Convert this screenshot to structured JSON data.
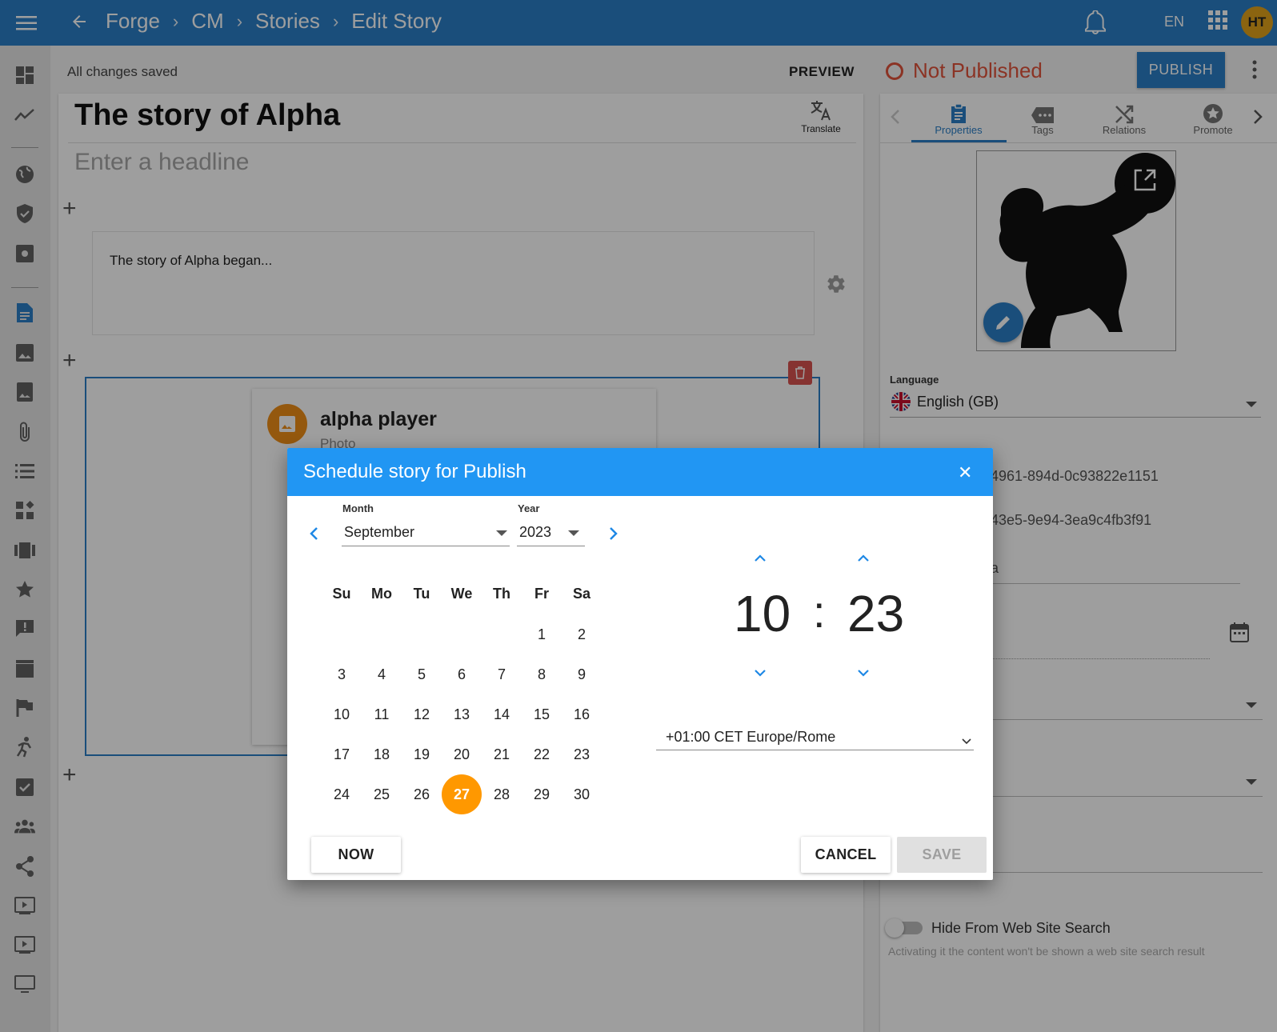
{
  "topbar": {
    "breadcrumbs": [
      "Forge",
      "CM",
      "Stories",
      "Edit Story"
    ],
    "language": "EN",
    "avatar_initials": "HT",
    "color": "#2b7fc7"
  },
  "toolbar": {
    "save_status": "All changes saved",
    "preview_label": "PREVIEW",
    "publish_status": "Not Published",
    "publish_label": "PUBLISH"
  },
  "editor": {
    "title": "The story of Alpha",
    "translate_label": "Translate",
    "headline_placeholder": "Enter a headline",
    "paragraph": "The story of Alpha began...",
    "media_card": {
      "name": "alpha player",
      "type": "Photo"
    }
  },
  "panel": {
    "tabs": [
      {
        "label": "Properties",
        "icon": "clipboard-icon",
        "active": true
      },
      {
        "label": "Tags",
        "icon": "tag-icon",
        "active": false
      },
      {
        "label": "Relations",
        "icon": "shuffle-icon",
        "active": false
      },
      {
        "label": "Promote",
        "icon": "star-circle-icon",
        "active": false
      }
    ],
    "language_label": "Language",
    "language_value": "English (GB)",
    "id_fragment_1": "4961-894d-0c93822e1151",
    "id_fragment_2": "43e5-9e94-3ea9c4fb3f91",
    "field_fragment": "a",
    "hide_search_label": "Hide From Web Site Search",
    "hide_search_hint": "Activating it the content won't be shown a web site search result"
  },
  "dialog": {
    "title": "Schedule story for Publish",
    "month_label": "Month",
    "month_value": "September",
    "year_label": "Year",
    "year_value": "2023",
    "weekdays": [
      "Su",
      "Mo",
      "Tu",
      "We",
      "Th",
      "Fr",
      "Sa"
    ],
    "first_weekday_index": 5,
    "days_in_month": 30,
    "selected_day": 27,
    "hour": "10",
    "minute": "23",
    "colon": ":",
    "timezone": "+01:00 CET Europe/Rome",
    "now_label": "NOW",
    "cancel_label": "CANCEL",
    "save_label": "SAVE",
    "header_color": "#2196f3",
    "selected_color": "#ff9800"
  }
}
